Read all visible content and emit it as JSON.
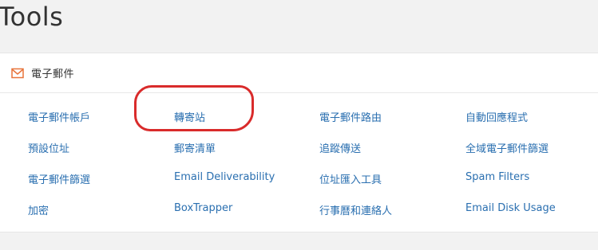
{
  "page": {
    "title": "Tools"
  },
  "section": {
    "title": "電子郵件",
    "icon": "envelope-icon",
    "accent": "#e8743b"
  },
  "links": [
    {
      "id": "email-accounts",
      "label": "電子郵件帳戶"
    },
    {
      "id": "forwarders",
      "label": "轉寄站"
    },
    {
      "id": "email-routing",
      "label": "電子郵件路由"
    },
    {
      "id": "autoresponders",
      "label": "自動回應程式"
    },
    {
      "id": "default-address",
      "label": "預設位址"
    },
    {
      "id": "mailing-lists",
      "label": "郵寄清單"
    },
    {
      "id": "track-delivery",
      "label": "追蹤傳送"
    },
    {
      "id": "global-email-filters",
      "label": "全域電子郵件篩選"
    },
    {
      "id": "email-filters",
      "label": "電子郵件篩選"
    },
    {
      "id": "email-deliverability",
      "label": "Email Deliverability"
    },
    {
      "id": "address-importer",
      "label": "位址匯入工具"
    },
    {
      "id": "spam-filters",
      "label": "Spam Filters"
    },
    {
      "id": "encryption",
      "label": "加密"
    },
    {
      "id": "boxtrapper",
      "label": "BoxTrapper"
    },
    {
      "id": "calendars-contacts",
      "label": "行事曆和連絡人"
    },
    {
      "id": "email-disk-usage",
      "label": "Email Disk Usage"
    }
  ],
  "colors": {
    "link": "#2a6fb0",
    "highlight": "#d92b2b"
  }
}
